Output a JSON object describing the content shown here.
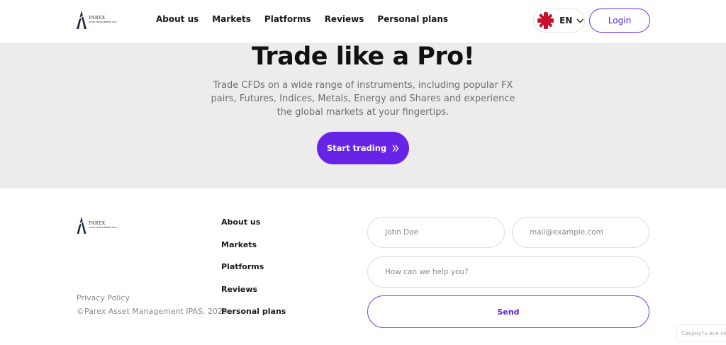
{
  "header": {
    "logo": {
      "brand": "PAREX",
      "sub": "ASSET MANAGEMENT IPAS"
    },
    "nav": [
      "About us",
      "Markets",
      "Platforms",
      "Reviews",
      "Personal plans"
    ],
    "language": {
      "code": "EN",
      "icon": "uk-flag-icon"
    },
    "login_label": "Login"
  },
  "hero": {
    "title": "Trade like a Pro!",
    "subtitle": "Trade CFDs on a wide range of instruments, including popular FX pairs, Futures, Indices, Metals, Energy and Shares and experience the global markets at your fingertips.",
    "cta_label": "Start trading",
    "cta_icon": "chevron-right-icon"
  },
  "footer": {
    "logo": {
      "brand": "PAREX",
      "sub": "ASSET MANAGEMENT IPAS"
    },
    "links": [
      "About us",
      "Markets",
      "Platforms",
      "Reviews",
      "Personal plans"
    ],
    "privacy": "Privacy Policy",
    "copyright": "©Parex Asset Management IPAS, 2025",
    "form": {
      "name_placeholder": "John Doe",
      "email_placeholder": "mail@example.com",
      "message_placeholder": "How can we help you?",
      "send_label": "Send"
    }
  },
  "overlay": {
    "toast_text": "Свернуть все окна"
  },
  "colors": {
    "accent": "#6824e6",
    "hero_bg": "#ececec",
    "text": "#1a1a1a",
    "muted": "#8a8a8a"
  }
}
